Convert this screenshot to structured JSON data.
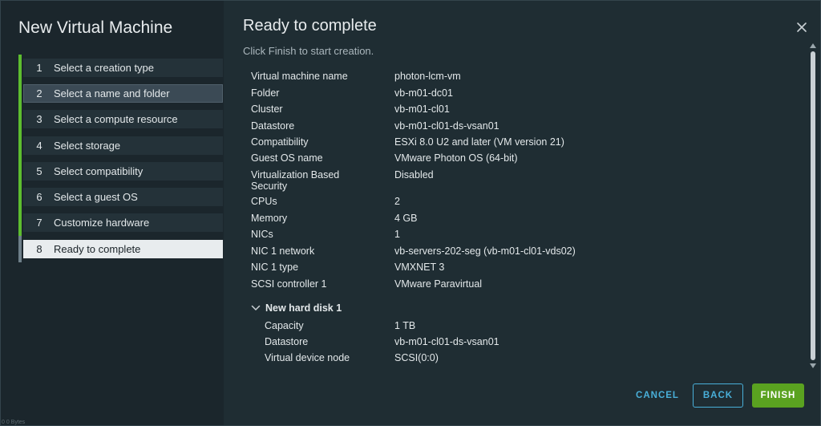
{
  "dialog": {
    "title": "New Virtual Machine",
    "corner_text": "0 0 Bytes"
  },
  "steps": [
    {
      "num": "1",
      "label": "Select a creation type"
    },
    {
      "num": "2",
      "label": "Select a name and folder"
    },
    {
      "num": "3",
      "label": "Select a compute resource"
    },
    {
      "num": "4",
      "label": "Select storage"
    },
    {
      "num": "5",
      "label": "Select compatibility"
    },
    {
      "num": "6",
      "label": "Select a guest OS"
    },
    {
      "num": "7",
      "label": "Customize hardware"
    },
    {
      "num": "8",
      "label": "Ready to complete"
    }
  ],
  "page": {
    "title": "Ready to complete",
    "subtitle": "Click Finish to start creation."
  },
  "summary": [
    {
      "key": "Virtual machine name",
      "value": "photon-lcm-vm"
    },
    {
      "key": "Folder",
      "value": "vb-m01-dc01"
    },
    {
      "key": "Cluster",
      "value": "vb-m01-cl01"
    },
    {
      "key": "Datastore",
      "value": "vb-m01-cl01-ds-vsan01"
    },
    {
      "key": "Compatibility",
      "value": "ESXi 8.0 U2 and later (VM version 21)"
    },
    {
      "key": "Guest OS name",
      "value": "VMware Photon OS (64-bit)"
    },
    {
      "key": "Virtualization Based Security",
      "value": "Disabled"
    },
    {
      "key": "CPUs",
      "value": "2"
    },
    {
      "key": "Memory",
      "value": "4 GB"
    },
    {
      "key": "NICs",
      "value": "1"
    },
    {
      "key": "NIC 1 network",
      "value": "vb-servers-202-seg (vb-m01-cl01-vds02)"
    },
    {
      "key": "NIC 1 type",
      "value": "VMXNET 3"
    },
    {
      "key": "SCSI controller 1",
      "value": "VMware Paravirtual"
    }
  ],
  "disk": {
    "header": "New hard disk 1",
    "rows": [
      {
        "key": "Capacity",
        "value": "1 TB"
      },
      {
        "key": "Datastore",
        "value": "vb-m01-cl01-ds-vsan01"
      },
      {
        "key": "Virtual device node",
        "value": "SCSI(0:0)"
      }
    ]
  },
  "buttons": {
    "cancel": "CANCEL",
    "back": "BACK",
    "finish": "FINISH"
  },
  "colors": {
    "accent_green": "#5aa220",
    "link_blue": "#49afd9",
    "progress_green": "#5dbd2f"
  },
  "icons": {
    "close": "close-icon",
    "disk_toggle": "chevron-down-icon"
  }
}
